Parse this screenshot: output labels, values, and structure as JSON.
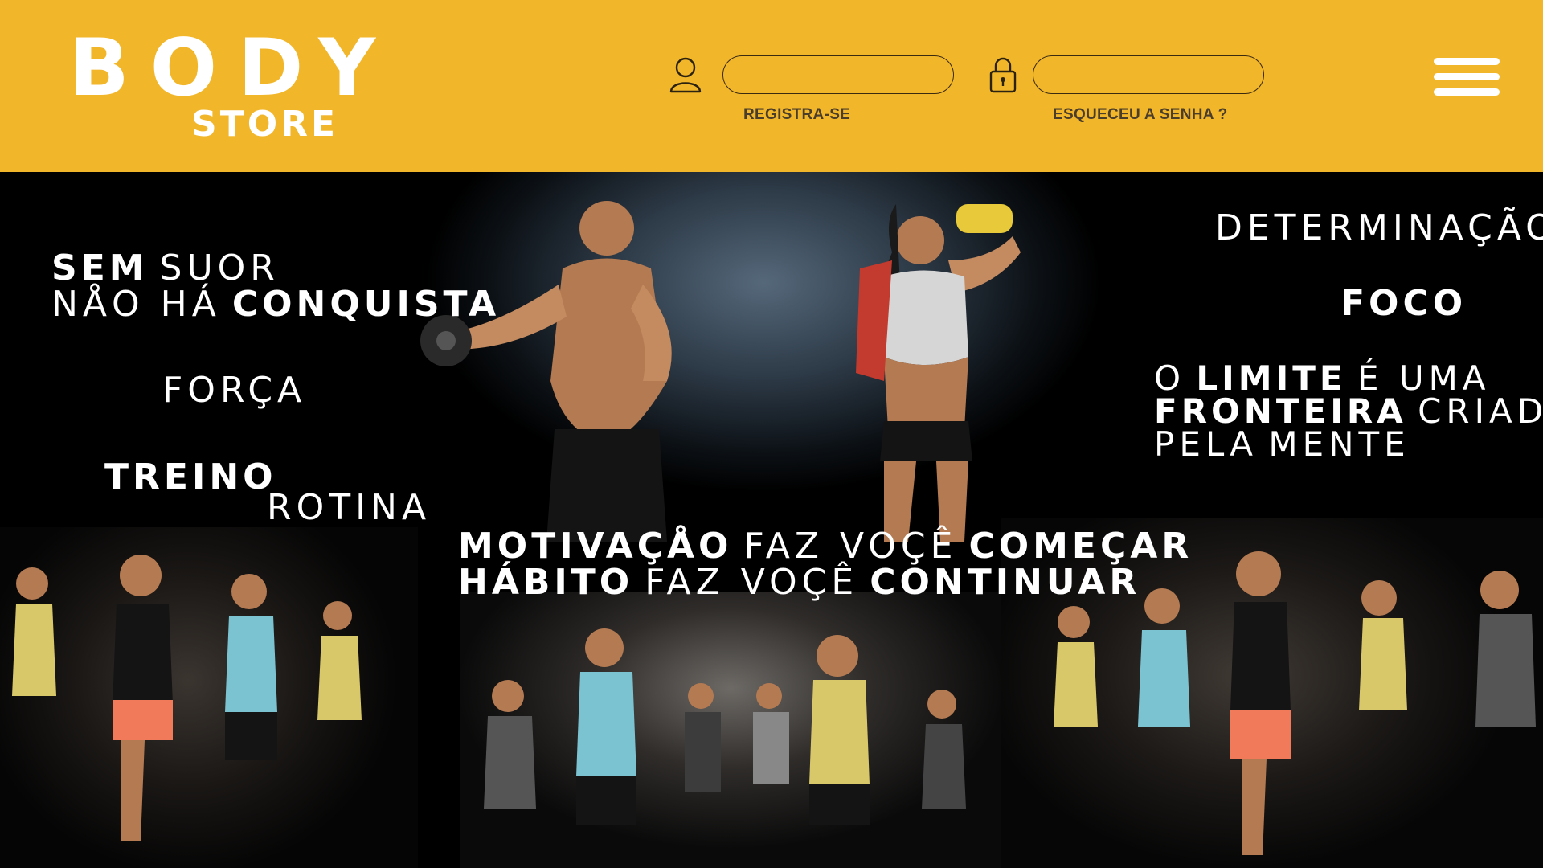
{
  "brand": {
    "line1": "BODY",
    "line2": "STORE"
  },
  "login": {
    "user_value": "",
    "password_value": "",
    "register_label": "REGISTRA-SE",
    "forgot_label": "ESQUECEU A SENHA ?"
  },
  "icons": {
    "user": "user-icon",
    "lock": "lock-icon",
    "menu": "hamburger-menu-icon"
  },
  "colors": {
    "header_bg": "#f2b62a",
    "hero_bg": "#000000",
    "text": "#ffffff",
    "link": "#4a3d2a"
  },
  "hero": {
    "left": {
      "sem": "SEM",
      "suor": "SUOR",
      "nao_ha": "NÅO HÁ",
      "conquista": "CONQUISTA",
      "forca": "FORÇA",
      "treino": "TREINO",
      "rotina": "ROTINA"
    },
    "right": {
      "determinacao": "DETERMINAÇÃO",
      "foco": "FOCO",
      "o": "O",
      "limite": "LIMITE",
      "e_uma": "É UMA",
      "fronteira": "FRONTEIRA",
      "criada": "CRIADA",
      "pela": "PELA",
      "mente": "MENTE"
    },
    "center": {
      "motivacao": "MOTIVAÇÅO",
      "faz_voce_1": "FAZ VOÇÊ",
      "comecar": "COMEÇAR",
      "habito": "HÁBITO",
      "faz_voce_2": "FAZ VOÇÊ",
      "continuar": "CONTINUAR"
    }
  }
}
